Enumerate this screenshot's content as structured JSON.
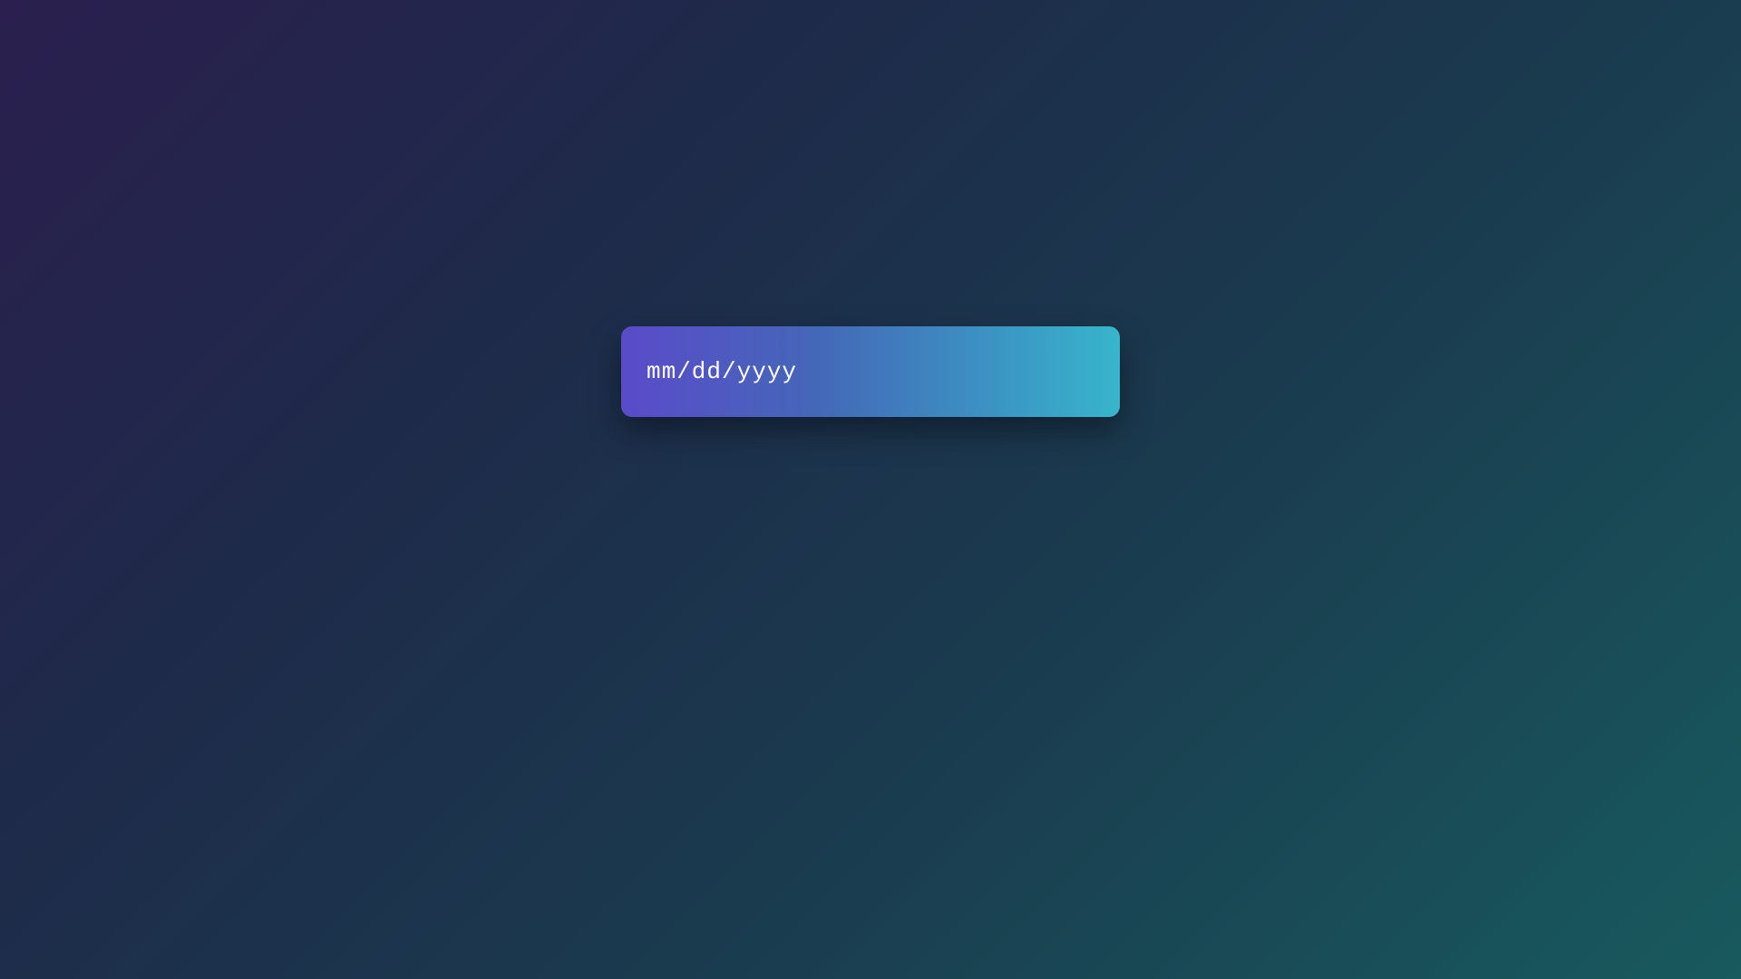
{
  "dateInput": {
    "placeholder": "mm/dd/yyyy",
    "value": ""
  }
}
